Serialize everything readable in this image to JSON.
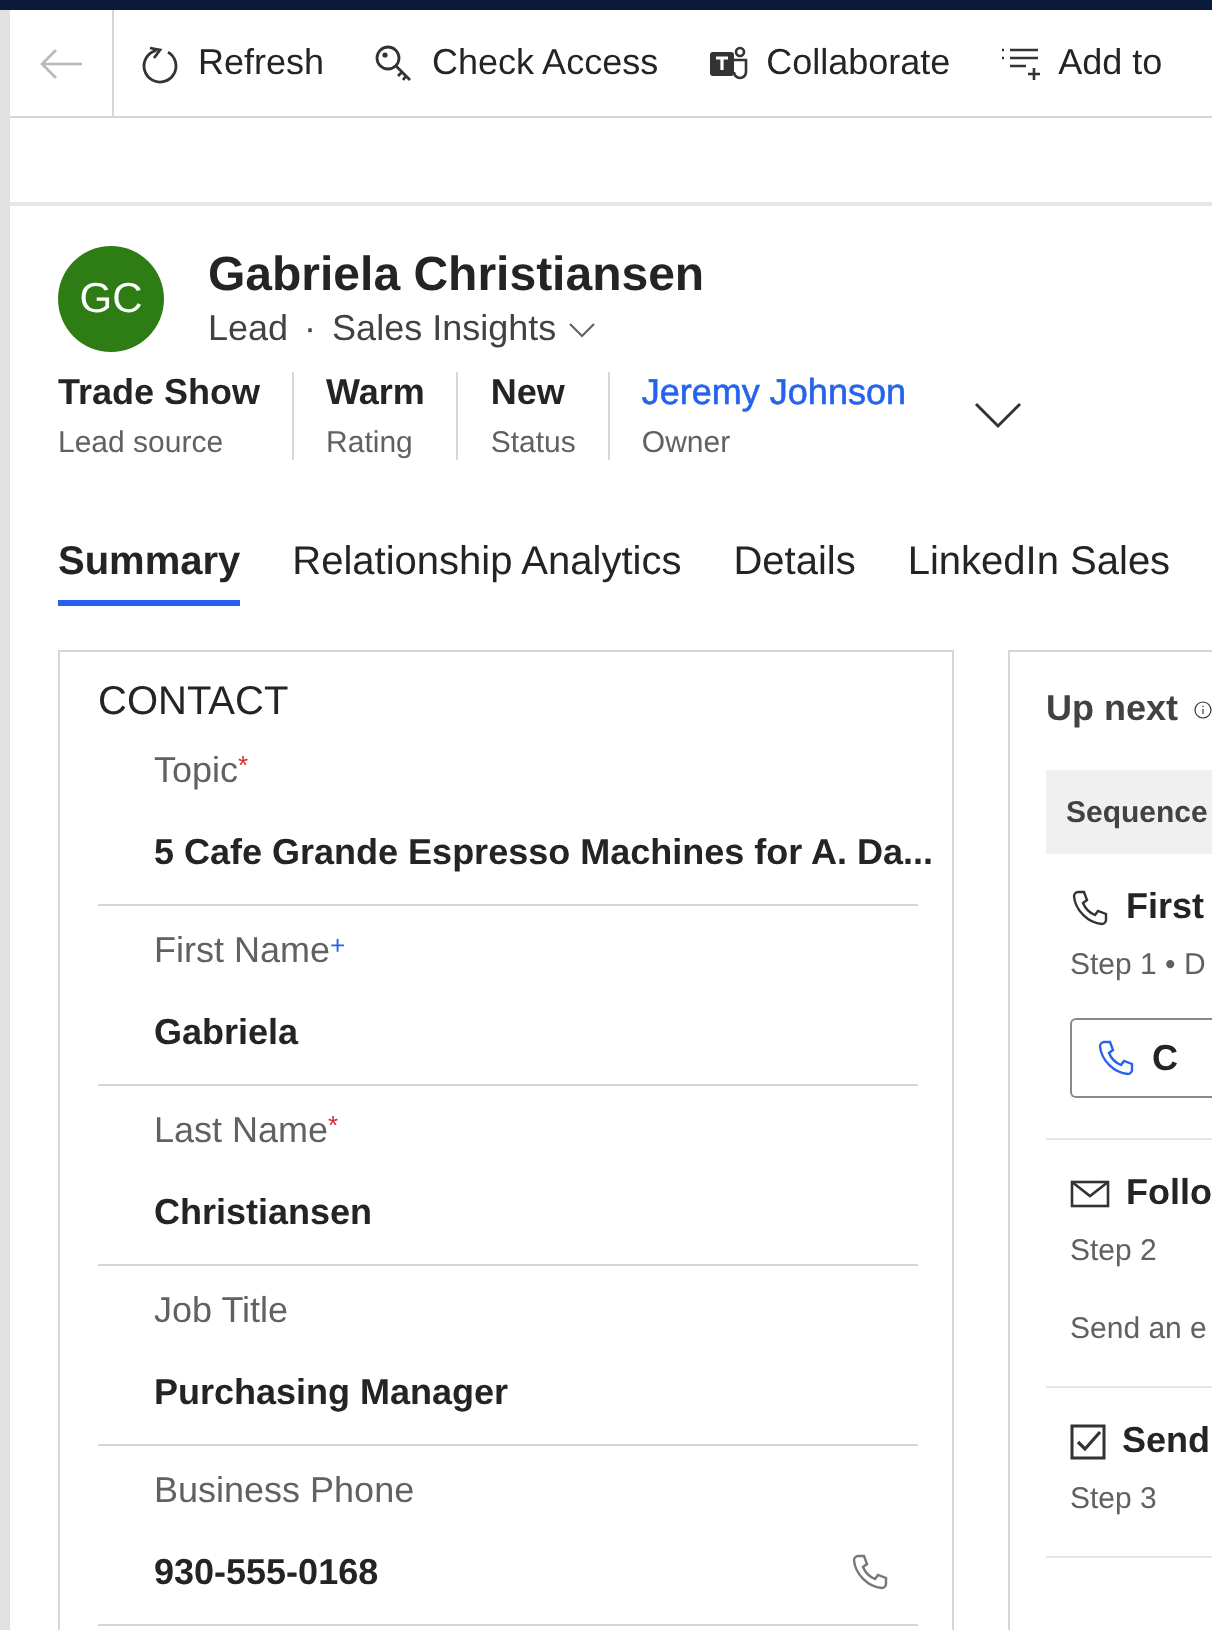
{
  "toolbar": {
    "back_disabled": true,
    "buttons": [
      {
        "label": "Refresh"
      },
      {
        "label": "Check Access"
      },
      {
        "label": "Collaborate"
      },
      {
        "label": "Add to"
      }
    ]
  },
  "record": {
    "initials": "GC",
    "name": "Gabriela Christiansen",
    "entity": "Lead",
    "separator": "·",
    "form": "Sales Insights",
    "header_fields": [
      {
        "value": "Trade Show",
        "label": "Lead source",
        "kind": "text"
      },
      {
        "value": "Warm",
        "label": "Rating",
        "kind": "text"
      },
      {
        "value": "New",
        "label": "Status",
        "kind": "text"
      },
      {
        "value": "Jeremy Johnson",
        "label": "Owner",
        "kind": "link"
      }
    ]
  },
  "tabs": [
    {
      "label": "Summary",
      "selected": true
    },
    {
      "label": "Relationship Analytics",
      "selected": false
    },
    {
      "label": "Details",
      "selected": false
    },
    {
      "label": "LinkedIn Sales",
      "selected": false
    }
  ],
  "contact": {
    "title": "CONTACT",
    "fields": [
      {
        "label": "Topic",
        "marker": "*",
        "required": true,
        "value": "5 Cafe Grande Espresso Machines for A. Da...",
        "callable": false
      },
      {
        "label": "First Name",
        "marker": "+",
        "required": false,
        "value": "Gabriela",
        "callable": false
      },
      {
        "label": "Last Name",
        "marker": "*",
        "required": true,
        "value": "Christiansen",
        "callable": false
      },
      {
        "label": "Job Title",
        "value": "Purchasing Manager",
        "callable": false
      },
      {
        "label": "Business Phone",
        "value": "930-555-0168",
        "callable": true
      }
    ]
  },
  "up_next": {
    "title": "Up next",
    "sequence": "Sequence",
    "steps": [
      {
        "kind": "call",
        "title": "First",
        "subtitle": "Step 1 • D",
        "button": "C"
      },
      {
        "kind": "email",
        "title": "Follo",
        "subtitle": "Step 2",
        "detail": "Send an e"
      },
      {
        "kind": "task",
        "title": "Send",
        "subtitle": "Step 3"
      }
    ]
  }
}
